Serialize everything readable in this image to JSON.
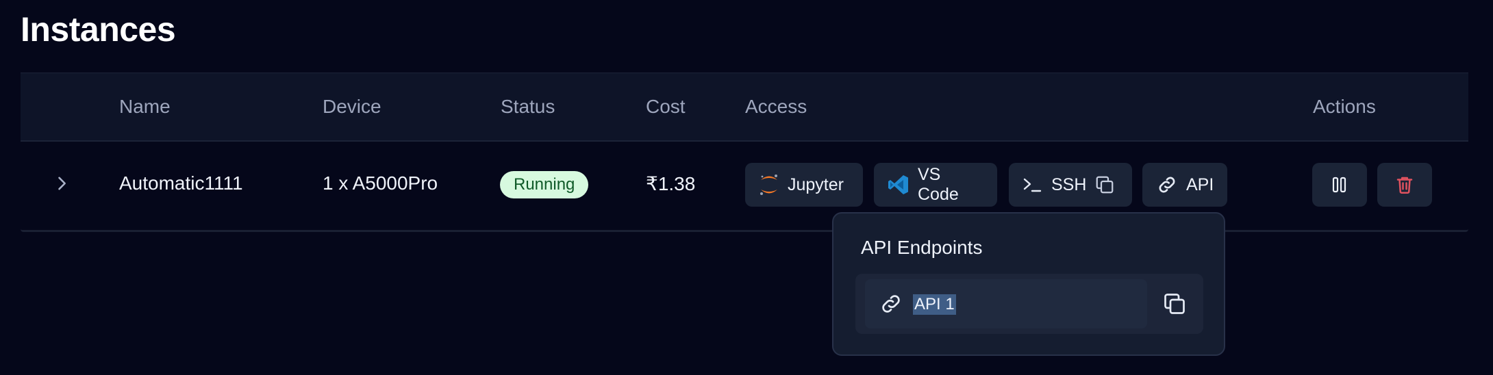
{
  "page": {
    "title": "Instances"
  },
  "table": {
    "headers": {
      "name": "Name",
      "device": "Device",
      "status": "Status",
      "cost": "Cost",
      "access": "Access",
      "actions": "Actions"
    },
    "rows": [
      {
        "name": "Automatic1111",
        "device": "1 x A5000Pro",
        "status": "Running",
        "cost": "₹1.38",
        "access": {
          "jupyter": "Jupyter",
          "vscode": "VS Code",
          "ssh": "SSH",
          "api": "API"
        }
      }
    ]
  },
  "popover": {
    "title": "API Endpoints",
    "endpoints": [
      {
        "label": "API 1"
      }
    ]
  },
  "colors": {
    "background": "#05071a",
    "header_bg": "#0e1428",
    "button_bg": "#1b2437",
    "running_badge_bg": "#d7f9df",
    "running_badge_text": "#0f5a28",
    "jupyter_orange": "#f37726",
    "vscode_blue": "#1f8ad2",
    "delete_red": "#e0525f"
  },
  "icons": [
    "chevron-right-icon",
    "jupyter-icon",
    "vscode-icon",
    "terminal-icon",
    "copy-icon",
    "link-icon",
    "pause-icon",
    "trash-icon"
  ]
}
